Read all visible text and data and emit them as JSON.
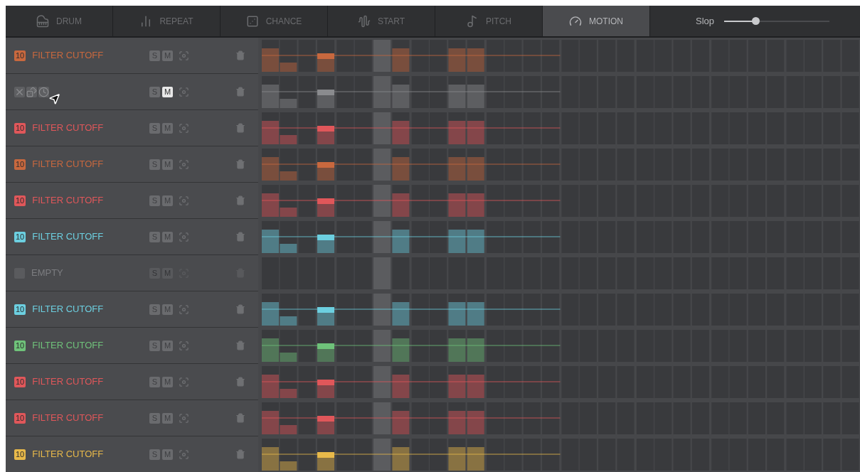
{
  "tabs": [
    {
      "label": "DRUM",
      "selected": false
    },
    {
      "label": "REPEAT",
      "selected": false
    },
    {
      "label": "CHANCE",
      "selected": false
    },
    {
      "label": "START",
      "selected": false
    },
    {
      "label": "PITCH",
      "selected": false
    },
    {
      "label": "MOTION",
      "selected": true
    }
  ],
  "slop": {
    "label": "Slop",
    "level": 0.3
  },
  "rows": [
    {
      "kind": "track",
      "badge": "10",
      "name": "FILTER CUTOFF",
      "color": "#c8683e",
      "solo_label": "S",
      "mute_label": "M",
      "solo": false,
      "muted": false
    },
    {
      "kind": "picker",
      "solo_label": "S",
      "mute_label": "M",
      "solo": false,
      "muted": true
    },
    {
      "kind": "track",
      "badge": "10",
      "name": "FILTER CUTOFF",
      "color": "#e0575a",
      "solo_label": "S",
      "mute_label": "M",
      "solo": false,
      "muted": false
    },
    {
      "kind": "track",
      "badge": "10",
      "name": "FILTER CUTOFF",
      "color": "#c8683e",
      "solo_label": "S",
      "mute_label": "M",
      "solo": false,
      "muted": false
    },
    {
      "kind": "track",
      "badge": "10",
      "name": "FILTER CUTOFF",
      "color": "#e0575a",
      "solo_label": "S",
      "mute_label": "M",
      "solo": false,
      "muted": false
    },
    {
      "kind": "track",
      "badge": "10",
      "name": "FILTER CUTOFF",
      "color": "#6ccfe0",
      "solo_label": "S",
      "mute_label": "M",
      "solo": false,
      "muted": false
    },
    {
      "kind": "empty",
      "name": "EMPTY",
      "solo_label": "S",
      "mute_label": "M",
      "solo": false,
      "muted": false
    },
    {
      "kind": "track",
      "badge": "10",
      "name": "FILTER CUTOFF",
      "color": "#6ccfe0",
      "solo_label": "S",
      "mute_label": "M",
      "solo": false,
      "muted": false
    },
    {
      "kind": "track",
      "badge": "10",
      "name": "FILTER CUTOFF",
      "color": "#6fc27a",
      "solo_label": "S",
      "mute_label": "M",
      "solo": false,
      "muted": false
    },
    {
      "kind": "track",
      "badge": "10",
      "name": "FILTER CUTOFF",
      "color": "#e0575a",
      "solo_label": "S",
      "mute_label": "M",
      "solo": false,
      "muted": false
    },
    {
      "kind": "track",
      "badge": "10",
      "name": "FILTER CUTOFF",
      "color": "#e0575a",
      "solo_label": "S",
      "mute_label": "M",
      "solo": false,
      "muted": false
    },
    {
      "kind": "track",
      "badge": "10",
      "name": "FILTER CUTOFF",
      "color": "#e8b94a",
      "solo_label": "S",
      "mute_label": "M",
      "solo": false,
      "muted": false
    }
  ]
}
